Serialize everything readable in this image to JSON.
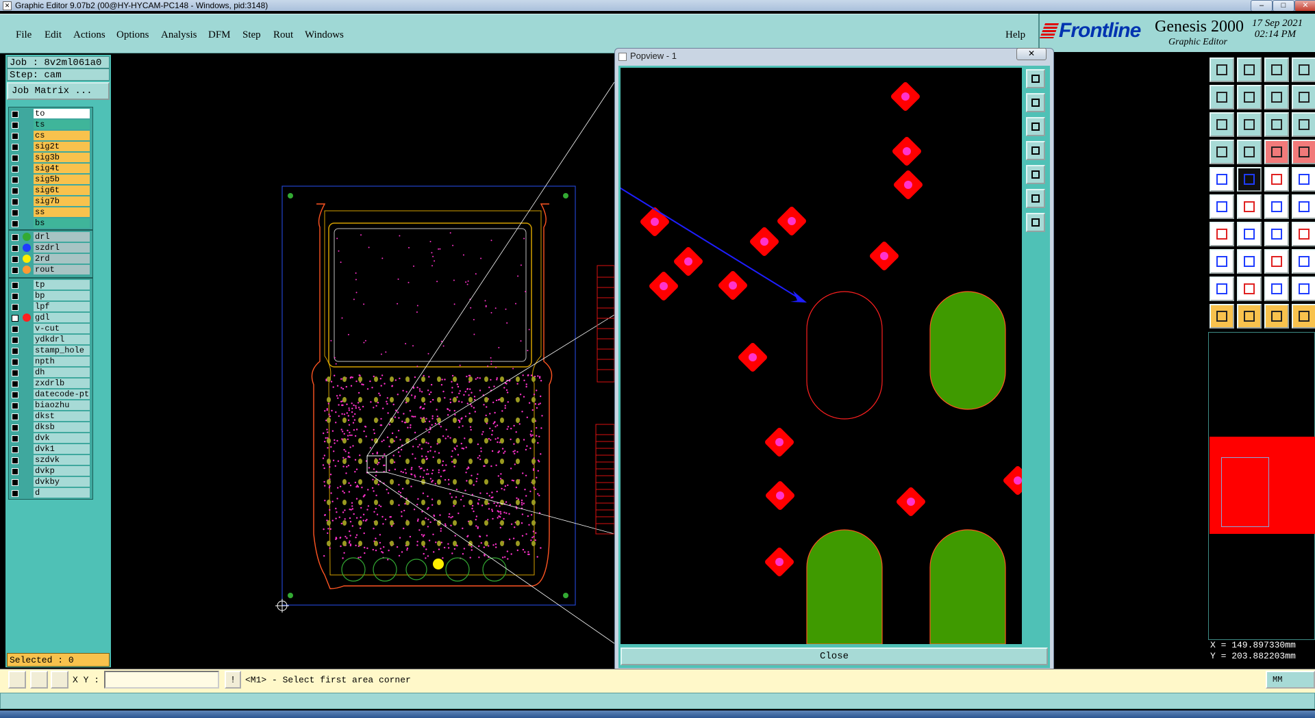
{
  "window": {
    "title": "Graphic Editor 9.07b2 (00@HY-HYCAM-PC148 - Windows, pid:3148)",
    "min": "–",
    "max": "□",
    "close": "✕"
  },
  "menu": {
    "items": [
      "File",
      "Edit",
      "Actions",
      "Options",
      "Analysis",
      "DFM",
      "Step",
      "Rout",
      "Windows"
    ],
    "help": "Help"
  },
  "brand": {
    "logo_a": "Front",
    "logo_b": "line",
    "product": "Genesis 2000",
    "subtitle": "Graphic Editor",
    "date": "17 Sep 2021\n 02:14 PM"
  },
  "job": {
    "job_label": "Job : 8v2ml061a0",
    "step_label": "Step: cam",
    "matrix_button": "Job Matrix ..."
  },
  "layers": {
    "board": [
      {
        "name": "to",
        "color": "#ffffff"
      },
      {
        "name": "ts",
        "color": "#3fb59a"
      },
      {
        "name": "cs",
        "color": "#f8c24d"
      },
      {
        "name": "sig2t",
        "color": "#f8c24d"
      },
      {
        "name": "sig3b",
        "color": "#f8c24d"
      },
      {
        "name": "sig4t",
        "color": "#f8c24d"
      },
      {
        "name": "sig5b",
        "color": "#f8c24d"
      },
      {
        "name": "sig6t",
        "color": "#f8c24d"
      },
      {
        "name": "sig7b",
        "color": "#f8c24d"
      },
      {
        "name": "ss",
        "color": "#f8c24d"
      },
      {
        "name": "bs",
        "color": "#3fb59a"
      }
    ],
    "drill": [
      {
        "name": "drl",
        "color": "#a7c4c4",
        "dot": "#33aa33"
      },
      {
        "name": "szdrl",
        "color": "#a7c4c4",
        "dot": "#1e3cff"
      },
      {
        "name": "2rd",
        "color": "#a7c4c4",
        "dot": "#ffee00"
      },
      {
        "name": "rout",
        "color": "#a7c4c4",
        "dot": "#ff9933"
      }
    ],
    "misc": [
      {
        "name": "tp",
        "color": "#a7dad6"
      },
      {
        "name": "bp",
        "color": "#a7dad6"
      },
      {
        "name": "lpf",
        "color": "#a7dad6"
      },
      {
        "name": "gdl",
        "color": "#a7dad6",
        "dot": "#ff2020",
        "active": true
      },
      {
        "name": "v-cut",
        "color": "#a7dad6"
      },
      {
        "name": "ydkdrl",
        "color": "#a7dad6"
      },
      {
        "name": "stamp_hole",
        "color": "#a7dad6"
      },
      {
        "name": "npth",
        "color": "#a7dad6"
      },
      {
        "name": "dh",
        "color": "#a7dad6"
      },
      {
        "name": "zxdrlb",
        "color": "#a7dad6"
      },
      {
        "name": "datecode-ptc",
        "color": "#a7dad6"
      },
      {
        "name": "biaozhu",
        "color": "#a7dad6"
      },
      {
        "name": "dkst",
        "color": "#a7dad6"
      },
      {
        "name": "dksb",
        "color": "#a7dad6"
      },
      {
        "name": "dvk",
        "color": "#a7dad6"
      },
      {
        "name": "dvk1",
        "color": "#a7dad6"
      },
      {
        "name": "szdvk",
        "color": "#a7dad6"
      },
      {
        "name": "dvkp",
        "color": "#a7dad6"
      },
      {
        "name": "dvkby",
        "color": "#a7dad6"
      },
      {
        "name": "d",
        "color": "#a7dad6"
      }
    ]
  },
  "selected": "Selected : 0",
  "popview": {
    "title": "Popview - 1",
    "close_label": "Close",
    "close_x": "✕"
  },
  "status": {
    "xy_label": "X Y :",
    "xy_value": "",
    "xy_bang": "!",
    "prompt": "<M1> - Select first area corner",
    "units": "MM"
  },
  "coords": {
    "x": "X = 149.897330mm",
    "y": "Y = 203.882203mm"
  },
  "colors": {
    "panel": "#9fd8d5",
    "left_panel": "#4fc1b6",
    "pad": "#ff0000",
    "via": "#ff33cc",
    "slot_fill": "#3f9a00",
    "annotation_arrow": "#1e1eff"
  }
}
